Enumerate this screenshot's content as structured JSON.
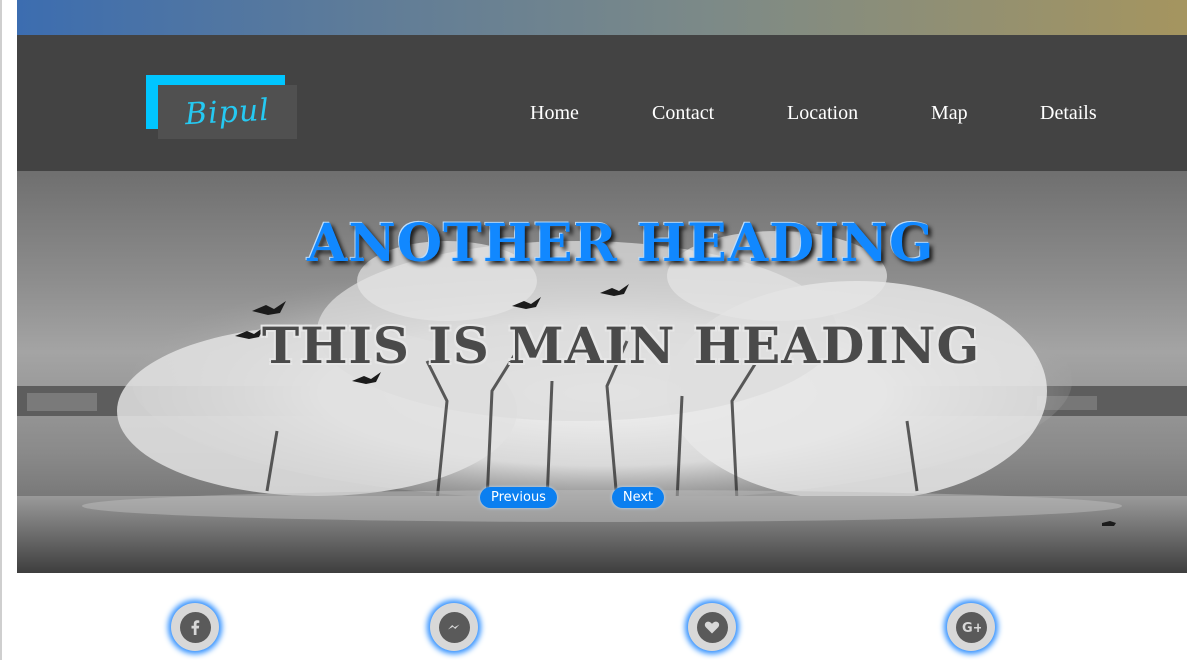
{
  "logo": {
    "text": "Bipul"
  },
  "nav": {
    "items": [
      {
        "label": "Home"
      },
      {
        "label": "Contact"
      },
      {
        "label": "Location"
      },
      {
        "label": "Map"
      },
      {
        "label": "Details"
      }
    ]
  },
  "hero": {
    "sub_heading": "ANOTHER HEADING",
    "main_heading": "THIS IS MAIN HEADING",
    "prev_label": "Previous",
    "next_label": "Next"
  },
  "social": {
    "icons": [
      "facebook-icon",
      "messenger-icon",
      "heart-icon",
      "google-plus-icon"
    ]
  },
  "colors": {
    "navbar": "#434343",
    "logo_accent": "#00c6ff",
    "sub_heading": "#1188ff",
    "button": "#0b7ff0",
    "icon_glow": "#2e8fff"
  }
}
